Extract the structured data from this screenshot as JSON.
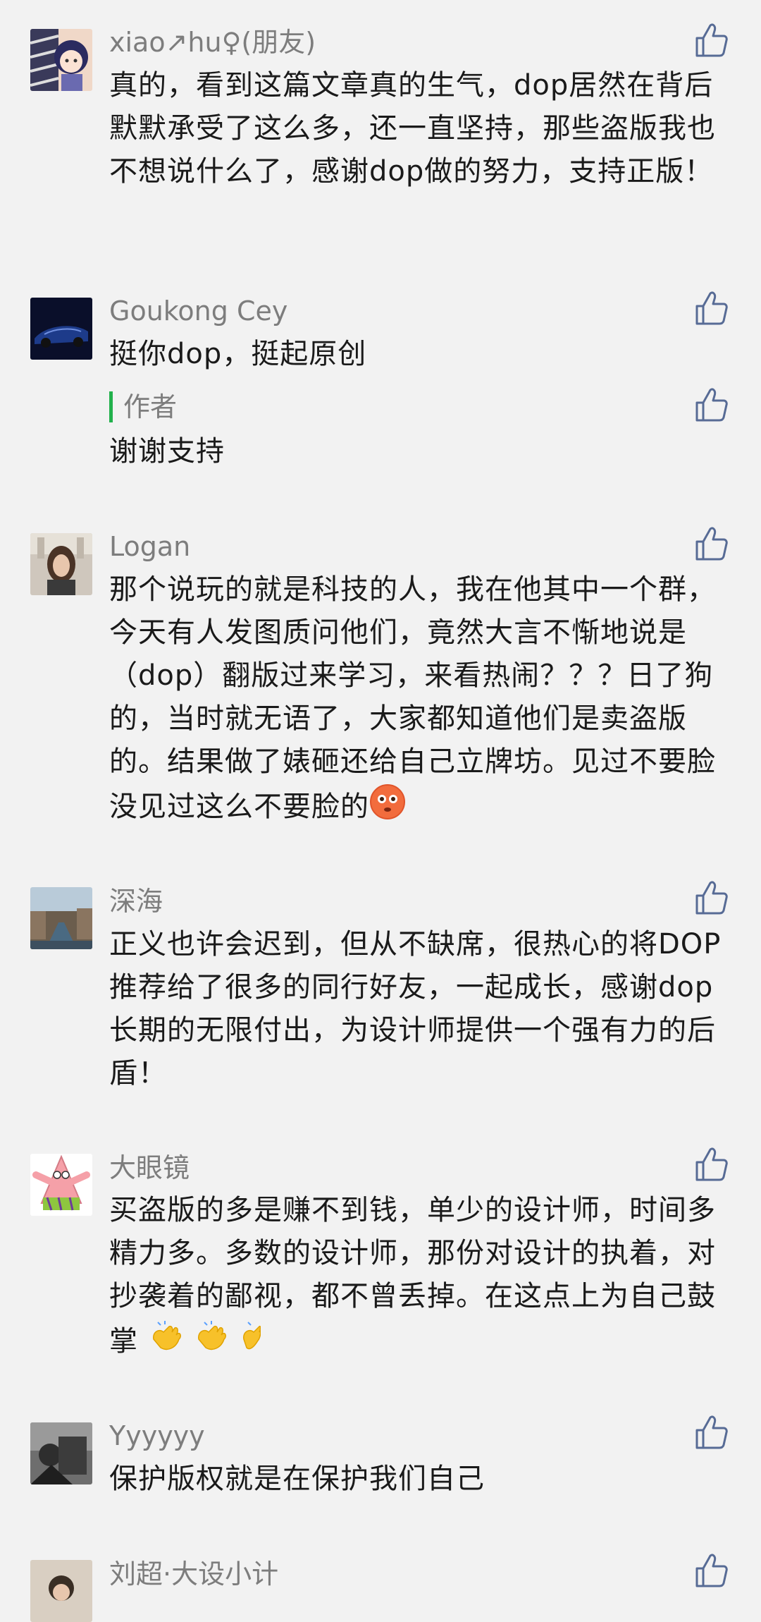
{
  "accent": "#576b95",
  "author_bar_color": "#22b14c",
  "comments": [
    {
      "name": "xiao↗hu♀(朋友)",
      "text": "真的，看到这篇文章真的生气，dop居然在背后默默承受了这么多，还一直坚持，那些盗版我也不想说什么了，感谢dop做的努力，支持正版！",
      "like_icon": "thumbs-up-icon"
    },
    {
      "name": "Goukong Cey",
      "text": "挺你dop，挺起原创",
      "like_icon": "thumbs-up-icon",
      "reply": {
        "label": "作者",
        "text": "谢谢支持"
      }
    },
    {
      "name": "Logan",
      "text": "那个说玩的就是科技的人，我在他其中一个群，今天有人发图质问他们，竟然大言不惭地说是（dop）翻版过来学习，来看热闹？？？日了狗的，当时就无语了，大家都知道他们是卖盗版的。结果做了婊砸还给自己立牌坊。见过不要脸没见过这么不要脸的",
      "like_icon": "thumbs-up-icon",
      "emoji": "flushed-face"
    },
    {
      "name": "深海",
      "text": "正义也许会迟到，但从不缺席，很热心的将DOP推荐给了很多的同行好友，一起成长，感谢dop长期的无限付出，为设计师提供一个强有力的后盾！",
      "like_icon": "thumbs-up-icon"
    },
    {
      "name": "大眼镜",
      "text": "买盗版的多是赚不到钱，单少的设计师，时间多精力多。多数的设计师，那份对设计的执着，对抄袭着的鄙视，都不曾丢掉。在这点上为自己鼓掌",
      "like_icon": "thumbs-up-icon",
      "emoji": "clapping-hands"
    },
    {
      "name": "Yyyyyy",
      "text": "保护版权就是在保护我们自己",
      "like_icon": "thumbs-up-icon"
    },
    {
      "name": "刘超·大设小计",
      "text": "",
      "like_icon": "thumbs-up-icon"
    }
  ]
}
